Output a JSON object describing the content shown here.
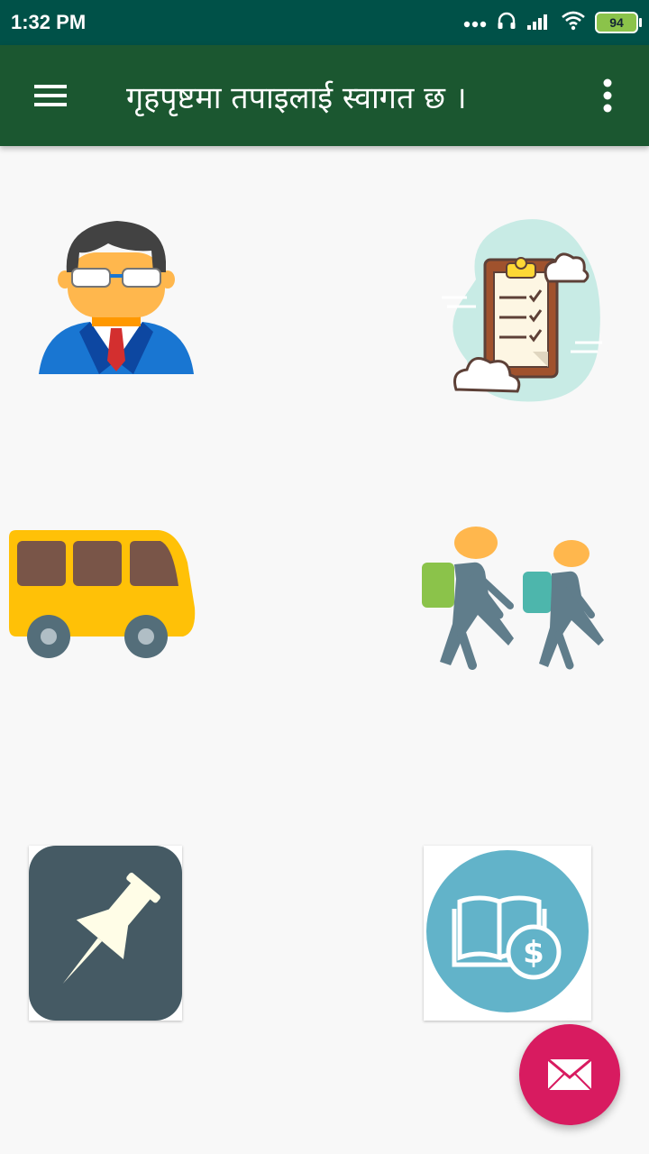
{
  "status_bar": {
    "time": "1:32 PM",
    "battery": "94"
  },
  "app_bar": {
    "title": "गृहपृष्टमा तपाइलाई स्वागत छ ।"
  },
  "tiles": [
    {
      "icon": "officer-icon"
    },
    {
      "icon": "clipboard-checklist-icon"
    },
    {
      "icon": "bus-icon"
    },
    {
      "icon": "students-walking-icon"
    },
    {
      "icon": "pin-icon"
    },
    {
      "icon": "book-fee-icon"
    }
  ],
  "fab": {
    "icon": "mail-icon"
  },
  "colors": {
    "status_bar": "#005148",
    "app_bar": "#1b5730",
    "fab": "#d81b60"
  }
}
